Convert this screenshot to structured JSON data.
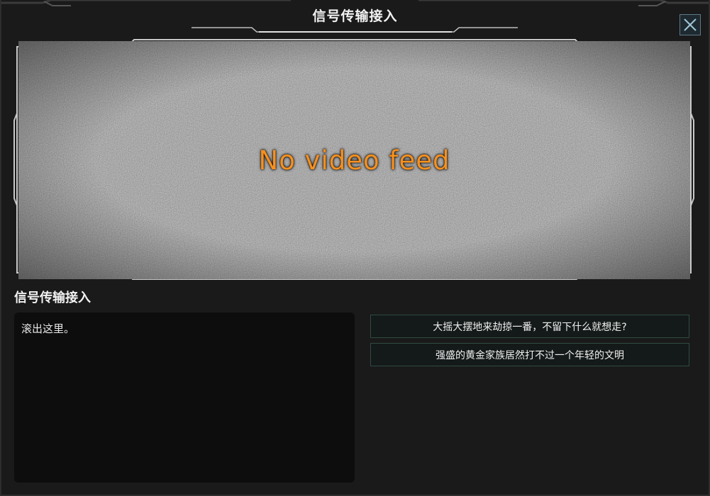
{
  "window": {
    "title": "信号传输接入"
  },
  "close_button": {
    "icon": "close-icon"
  },
  "video": {
    "status_text": "No video feed",
    "status_color": "#f7901e"
  },
  "transmission": {
    "heading": "信号传输接入",
    "message": "滚出这里。"
  },
  "options": [
    {
      "label": "大摇大摆地来劫掠一番，不留下什么就想走?"
    },
    {
      "label": "强盛的黄金家族居然打不过一个年轻的文明"
    }
  ],
  "colors": {
    "accent_orange": "#f7901e",
    "frame_gray": "#c9c9c9",
    "option_border": "#2f4a44"
  }
}
